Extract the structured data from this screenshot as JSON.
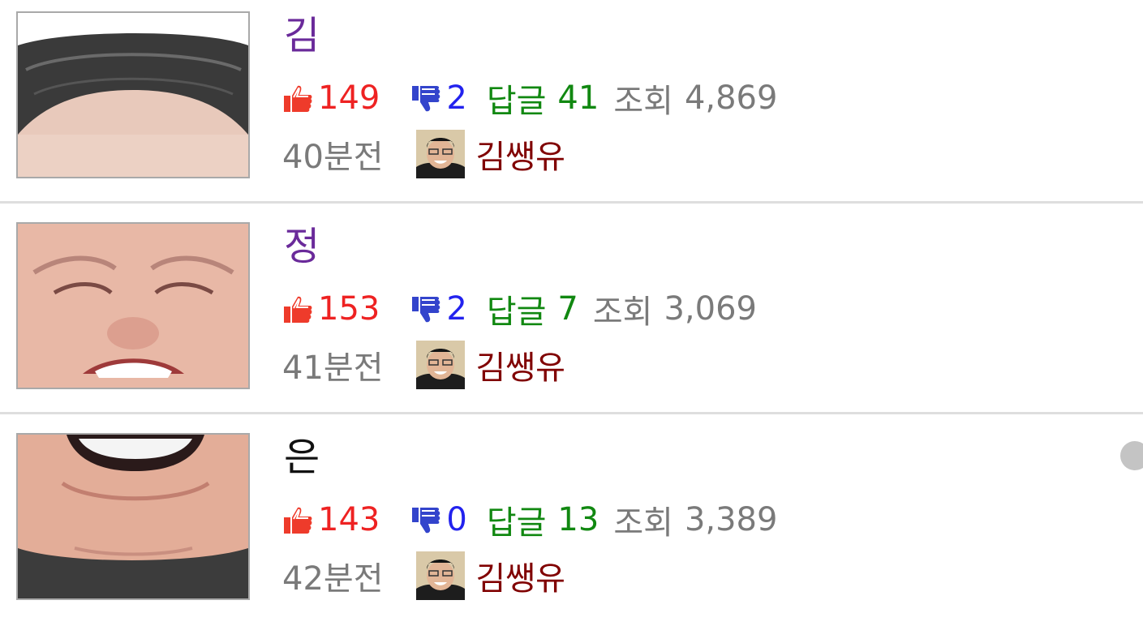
{
  "colors": {
    "like": "#ee2222",
    "dislike": "#2222ee",
    "reply": "#118811",
    "views": "#7a7a7a",
    "time": "#7a7a7a",
    "author": "#800000",
    "visited_title": "#6a2a9a",
    "unvisited_title": "#111111"
  },
  "posts": [
    {
      "title": "김",
      "likes": "149",
      "dislikes": "2",
      "reply_label": "답글",
      "replies": "41",
      "view_label": "조회",
      "views": "4,869",
      "time": "40분전",
      "author": "김쌩유",
      "thumbnail": "face-crop-hair"
    },
    {
      "title": "정",
      "likes": "153",
      "dislikes": "2",
      "reply_label": "답글",
      "replies": "7",
      "view_label": "조회",
      "views": "3,069",
      "time": "41분전",
      "author": "김쌩유",
      "thumbnail": "face-crop-eyes-nose"
    },
    {
      "title": "은",
      "likes": "143",
      "dislikes": "0",
      "reply_label": "답글",
      "replies": "13",
      "view_label": "조회",
      "views": "3,389",
      "time": "42분전",
      "author": "김쌩유",
      "thumbnail": "face-crop-mouth-chin"
    }
  ],
  "icons": {
    "like": "thumbs-up-icon",
    "dislike": "thumbs-down-icon"
  }
}
